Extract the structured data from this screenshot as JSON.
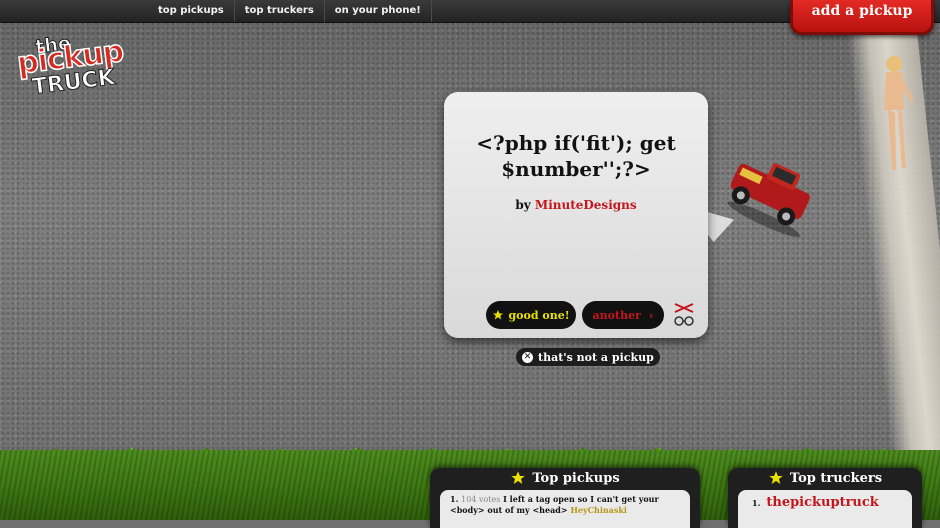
{
  "nav": {
    "items": [
      "top pickups",
      "top truckers",
      "on your phone!"
    ],
    "add_button": "add a pickup"
  },
  "logo": {
    "line1": "the",
    "line2": "pickup",
    "line3": "TRUCK"
  },
  "card": {
    "pickup_line": "<?php if('fit'); get $number'';?>",
    "by_prefix": "by",
    "author": "MinuteDesigns",
    "good_button": "good one!",
    "another_button": "another",
    "not_pickup": "that's not a pickup"
  },
  "top_pickups": {
    "title": "Top pickups",
    "entries": [
      {
        "rank": "1.",
        "votes": "104 votes",
        "text": "I left a tag open so I can't get your <body> out of my <head>",
        "user": "HeyChinaski"
      }
    ]
  },
  "top_truckers": {
    "title": "Top truckers",
    "entries": [
      {
        "rank": "1.",
        "name": "thepickuptruck"
      }
    ]
  },
  "colors": {
    "accent_red": "#c4161c",
    "accent_yellow": "#e9e000",
    "dark": "#111111"
  }
}
